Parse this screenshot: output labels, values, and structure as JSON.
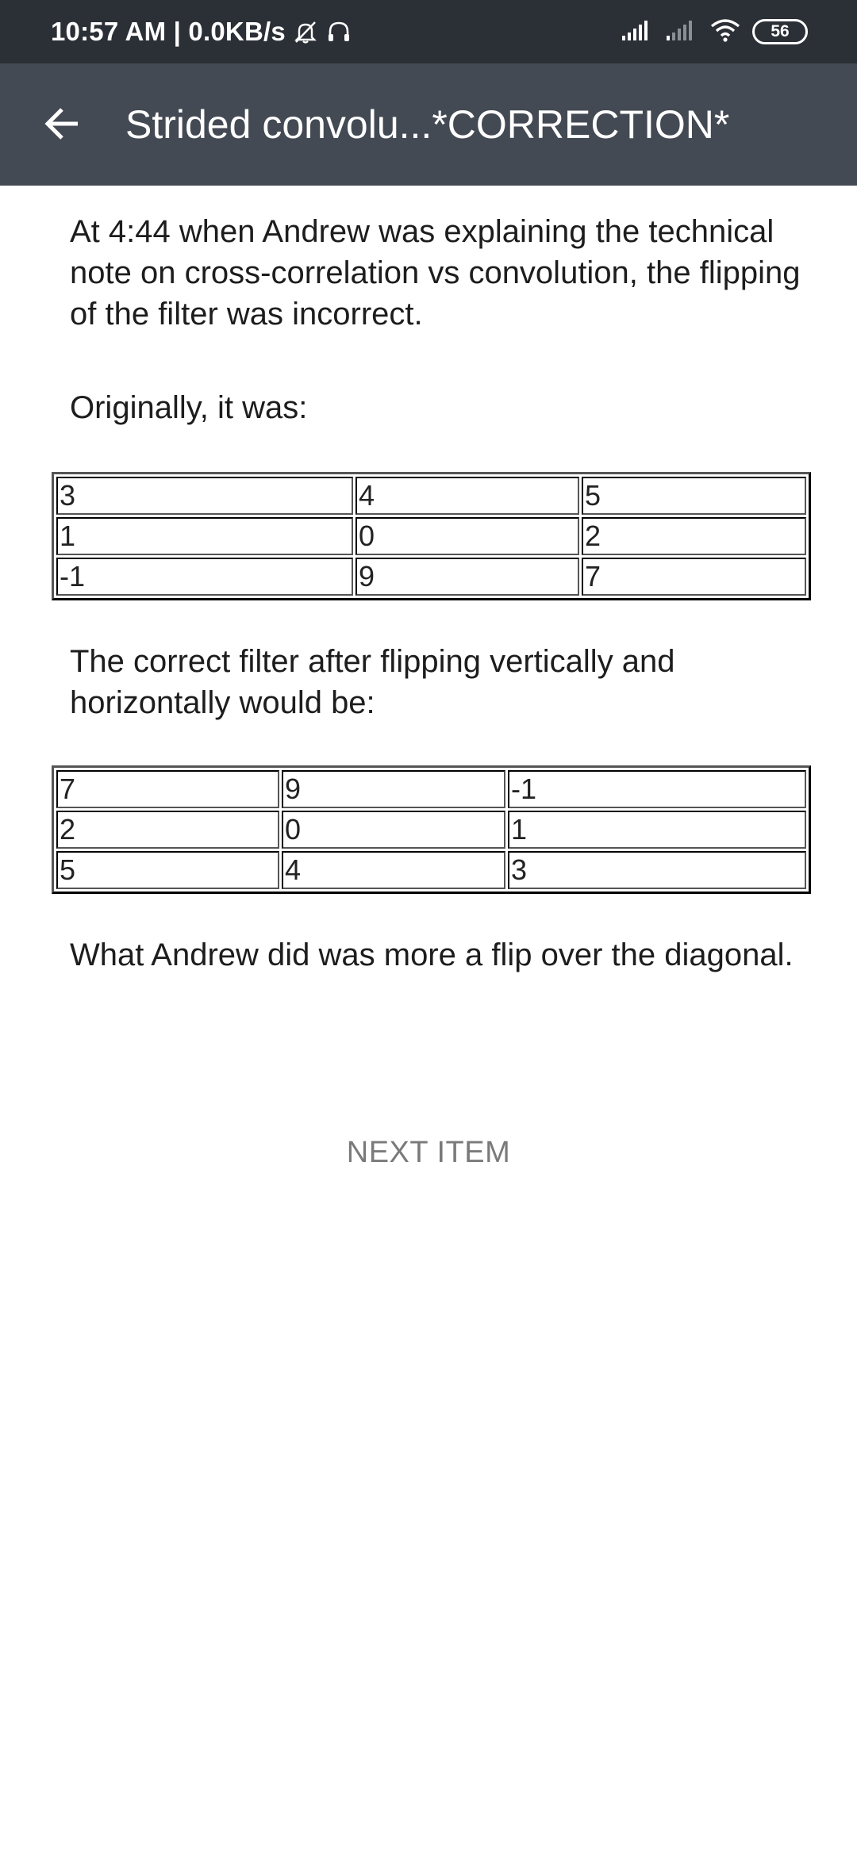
{
  "status_bar": {
    "time_speed": "10:57 AM | 0.0KB/s",
    "icons": [
      "mute-bell-icon",
      "headset-icon",
      "signal-icon",
      "signal-weak-icon",
      "wifi-icon"
    ],
    "battery": "56"
  },
  "app_bar": {
    "back_icon": "arrow-left-icon",
    "title": "Strided convolu...*CORRECTION*"
  },
  "content": {
    "intro": "At 4:44 when Andrew was explaining the technical note on cross-correlation vs convolution, the flipping of the filter was incorrect.",
    "originally": "Originally, it was:",
    "table1": [
      [
        "3",
        "4",
        "5"
      ],
      [
        "1",
        "0",
        "2"
      ],
      [
        "-1",
        "9",
        "7"
      ]
    ],
    "correct_text": "The correct filter after flipping vertically and horizontally would be:",
    "table2": [
      [
        "7",
        "9",
        "-1"
      ],
      [
        "2",
        "0",
        "1"
      ],
      [
        "5",
        "4",
        "3"
      ]
    ],
    "conclusion": "What Andrew did was more a flip over the diagonal."
  },
  "next_item_label": "NEXT ITEM",
  "colors": {
    "status_bar_bg": "#2b2f36",
    "app_bar_bg": "#444a53",
    "next_item_text": "#7a7a7a"
  }
}
